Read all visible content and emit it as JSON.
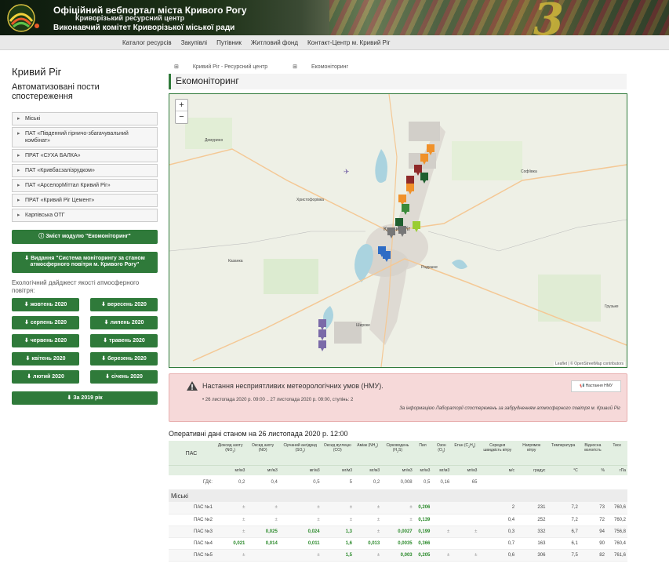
{
  "header": {
    "title": "Офіційний вебпортал міста Кривого Рогу",
    "subtitle": "Криворізький ресурсний центр",
    "committee": "Виконавчий комітет Криворізької міської ради",
    "accent": "#2f7a3a"
  },
  "nav": {
    "items": [
      {
        "label": "Каталог ресурсів"
      },
      {
        "label": "Закупівлі"
      },
      {
        "label": "Путівник"
      },
      {
        "label": "Житловий фонд"
      },
      {
        "label": "Контакт-Центр м. Кривий Ріг"
      }
    ]
  },
  "sidebar": {
    "city": "Кривий Ріг",
    "subtitle": "Автоматизовані пости спостереження",
    "items": [
      {
        "label": "Міські"
      },
      {
        "label": "ПАТ «Південний гірничо-збагачувальний комбінат»"
      },
      {
        "label": "ПРАТ «СУХА БАЛКА»"
      },
      {
        "label": "ПАТ «Кривбасзалізрудком»"
      },
      {
        "label": "ПАТ «АрселорМіттал Кривий Ріг»"
      },
      {
        "label": "ПРАТ «Кривий Ріг Цемент»"
      },
      {
        "label": "Карпівська ОТГ"
      }
    ],
    "module_button": "Зміст модулю \"Екомоніторинг\"",
    "publication_button": "Видання \"Система моніторингу за станом атмосферного повітря м. Кривого Рогу\"",
    "digest_label": "Екологічний дайджест якості атмосферного повітря:",
    "months": [
      {
        "label": "жовтень 2020"
      },
      {
        "label": "вересень 2020"
      },
      {
        "label": "серпень 2020"
      },
      {
        "label": "липень 2020"
      },
      {
        "label": "червень 2020"
      },
      {
        "label": "травень 2020"
      },
      {
        "label": "квітень 2020"
      },
      {
        "label": "березень 2020"
      },
      {
        "label": "лютий 2020"
      },
      {
        "label": "січень 2020"
      }
    ],
    "year_button": "За 2019 рік"
  },
  "breadcrumbs": [
    {
      "label": "Кривий Ріг - Ресурсний центр"
    },
    {
      "label": "Екомоніторинг"
    }
  ],
  "page_title": "Екомоніторинг",
  "map": {
    "zoom_in": "+",
    "zoom_out": "−",
    "attribution": "Leaflet | © OpenStreetMap contributors",
    "places": [
      {
        "label": "Кривий Ріг"
      },
      {
        "label": "Христофорівка"
      },
      {
        "label": "Софіївка"
      },
      {
        "label": "Радушне"
      },
      {
        "label": "Широке"
      },
      {
        "label": "Грузьке"
      },
      {
        "label": "Казанка"
      },
      {
        "label": "Демурино"
      }
    ],
    "marker_colors": {
      "orange": "#f0912a",
      "darkred": "#8f2a2a",
      "green": "#3a8a3a",
      "darkgreen": "#1f5f2f",
      "gray": "#777777",
      "lime": "#9acd32",
      "blue": "#2e6cc5",
      "purple": "#7a6aa8"
    }
  },
  "alert": {
    "title": "Настання несприятливих метеорологічних умов (НМУ).",
    "button": "Настання НМУ",
    "date": "26 листопада 2020 р. 09:00 .. 27 листопада 2020 р. 09:00, ступінь: 2",
    "note": "За інформацією Лабораторії спостережень за забрудненням атмосферного повітря м. Кривий Ріг",
    "bg_color": "#f6d9d9"
  },
  "operational_title": "Оперативні дані станом на 26 листопада 2020 р. 12:00",
  "table": {
    "pas_header": "ПАС",
    "gdk_label": "ГДК:",
    "gdk": [
      "0,2",
      "0,4",
      "0,5",
      "5",
      "0,2",
      "0,008",
      "0,5",
      "0,16",
      "65",
      "",
      "",
      "",
      "",
      ""
    ],
    "section": "Міські",
    "rows": [
      {
        "name": "ПАС №1",
        "cells": [
          "±",
          "±",
          "±",
          "±",
          "±",
          "±",
          "0,206",
          "",
          "",
          "2",
          "231",
          "7,2",
          "73",
          "760,6"
        ]
      },
      {
        "name": "ПАС №2",
        "cells": [
          "±",
          "±",
          "±",
          "±",
          "±",
          "±",
          "0,139",
          "",
          "",
          "0,4",
          "252",
          "7,2",
          "72",
          "760,2"
        ]
      },
      {
        "name": "ПАС №3",
        "cells": [
          "±",
          "0,025",
          "0,024",
          "1,3",
          "±",
          "0,0027",
          "0,199",
          "±",
          "±",
          "0,3",
          "332",
          "6,7",
          "94",
          "756,8"
        ]
      },
      {
        "name": "ПАС №4",
        "cells": [
          "0,021",
          "0,014",
          "0,011",
          "1,6",
          "0,013",
          "0,0035",
          "0,366",
          "",
          "",
          "0,7",
          "163",
          "6,1",
          "90",
          "760,4"
        ]
      },
      {
        "name": "ПАС №5",
        "cells": [
          "±",
          "",
          "±",
          "1,5",
          "±",
          "0,003",
          "0,205",
          "±",
          "±",
          "0,6",
          "306",
          "7,5",
          "82",
          "761,6"
        ]
      }
    ]
  }
}
